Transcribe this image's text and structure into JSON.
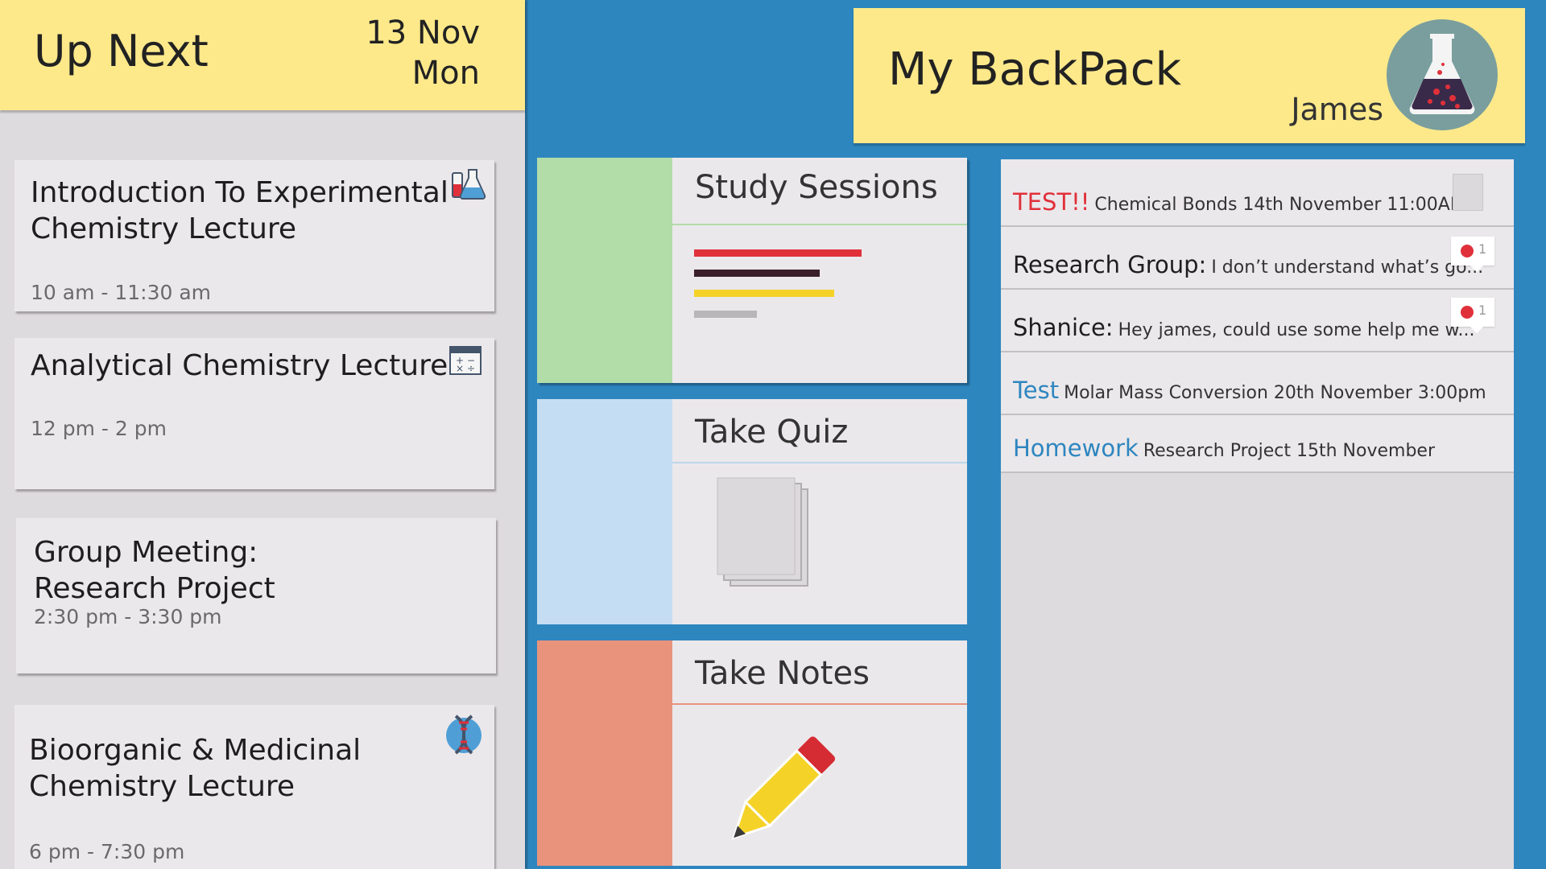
{
  "up_next": {
    "title": "Up Next",
    "date_line1": "13 Nov",
    "date_line2": "Mon",
    "events": [
      {
        "title": "Introduction To Experimental\nChemistry Lecture",
        "time": "10 am - 11:30 am",
        "icon": "flask-icon"
      },
      {
        "title": "Analytical Chemistry Lecture",
        "time": "12 pm - 2 pm",
        "icon": "calculator-icon"
      },
      {
        "title": "Group Meeting:\nResearch Project",
        "time": "2:30 pm - 3:30 pm",
        "icon": ""
      },
      {
        "title": "Bioorganic & Medicinal\nChemistry Lecture",
        "time": "6 pm - 7:30 pm",
        "icon": "dna-icon"
      }
    ]
  },
  "tiles": [
    {
      "label": "Study Sessions",
      "color": "#b2dca8",
      "rule_color": "#b2dca8",
      "icon": "lines-icon"
    },
    {
      "label": "Take Quiz",
      "color": "#c5ddf2",
      "rule_color": "#bcd6ec",
      "icon": "papers-icon"
    },
    {
      "label": "Take Notes",
      "color": "#e9937c",
      "rule_color": "#e9937c",
      "icon": "pencil-icon"
    }
  ],
  "backpack": {
    "title": "My BackPack",
    "user": "James",
    "avatar_icon": "flask-icon"
  },
  "feed": [
    {
      "tag": "TEST!!",
      "detail": "Chemical Bonds 14th November 11:00AM",
      "tag_color": "#e0303a",
      "control": "checkbox"
    },
    {
      "tag": "Research Group:",
      "detail": "I don’t understand what’s go...",
      "tag_color": "#1e1e1e",
      "control": "badge",
      "count": "1"
    },
    {
      "tag": "Shanice:",
      "detail": "Hey james, could use some help me w...",
      "tag_color": "#1e1e1e",
      "control": "badge",
      "count": "1"
    },
    {
      "tag": "Test",
      "detail": "Molar Mass Conversion 20th November 3:00pm",
      "tag_color": "#2e86bf",
      "control": ""
    },
    {
      "tag": "Homework",
      "detail": "Research Project 15th November",
      "tag_color": "#2e86bf",
      "control": ""
    }
  ],
  "colors": {
    "background": "#2e86bf",
    "header_yellow": "#fde98a",
    "panel_grey": "#dedbde",
    "card_grey": "#ebe8eb",
    "alert_red": "#e0303a"
  }
}
